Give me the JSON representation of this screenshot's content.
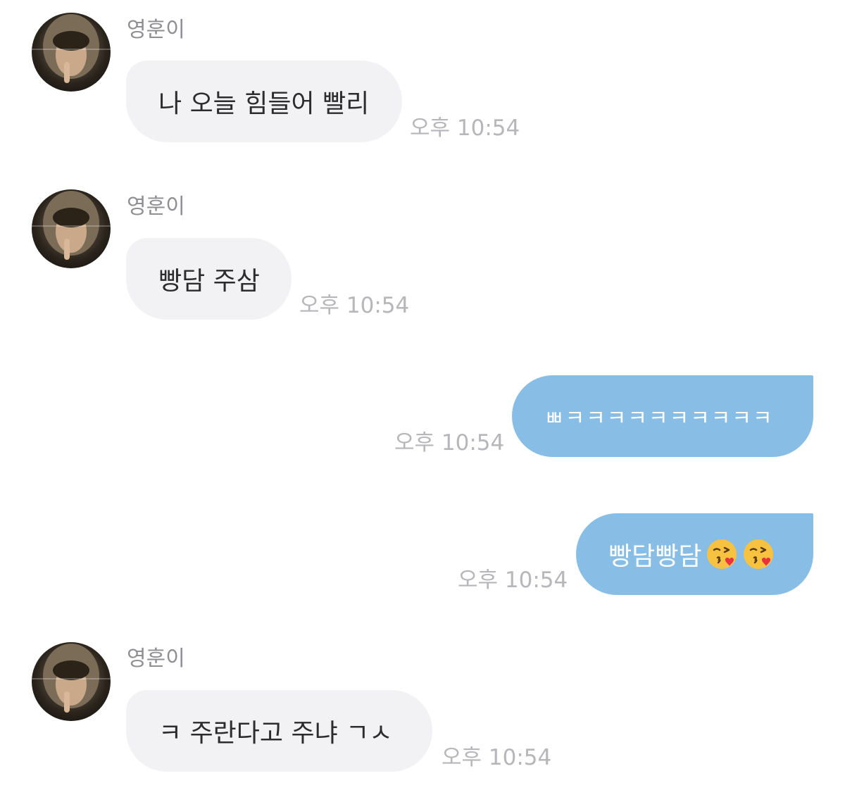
{
  "chat": {
    "messages": [
      {
        "direction": "incoming",
        "sender": "영훈이",
        "text": "나 오늘 힘들어 빨리",
        "time": "오후 10:54"
      },
      {
        "direction": "incoming",
        "sender": "영훈이",
        "text": "빵담 주삼",
        "time": "오후 10:54"
      },
      {
        "direction": "outgoing",
        "text": "ㅃㅋㅋㅋㅋㅋㅋㅋㅋㅋㅋ",
        "time": "오후 10:54"
      },
      {
        "direction": "outgoing",
        "text": "빵담빵담",
        "emoji": [
          "kissing-face-with-heart-emoji",
          "kissing-face-with-heart-emoji"
        ],
        "time": "오후 10:54"
      },
      {
        "direction": "incoming",
        "sender": "영훈이",
        "text": "ㅋ 주란다고 주냐 ㄱㅅ",
        "time": "오후 10:54"
      }
    ]
  },
  "colors": {
    "incoming_bubble": "#f2f2f5",
    "outgoing_bubble": "#88bde6",
    "timestamp": "#b6b6bb",
    "sender_name": "#8e8e93"
  }
}
